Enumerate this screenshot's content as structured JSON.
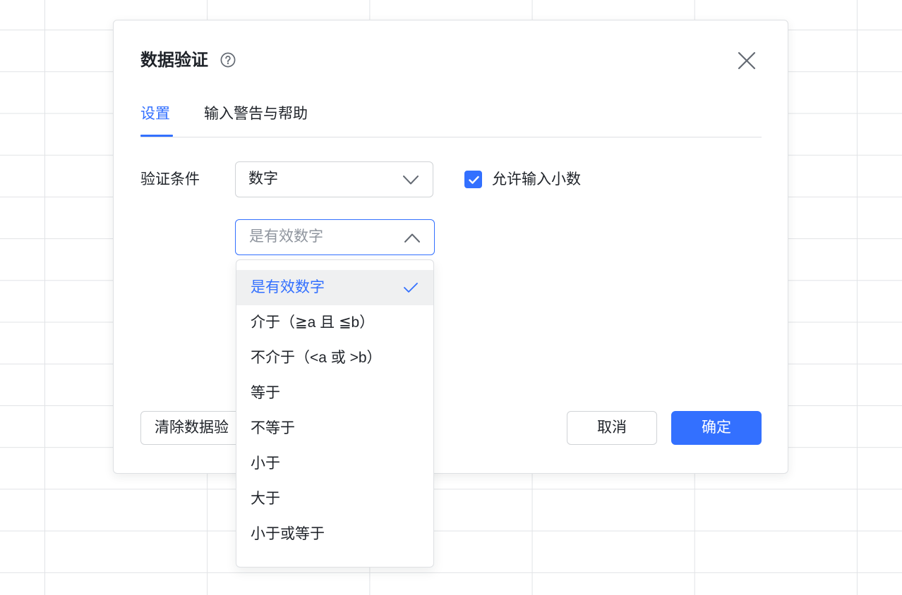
{
  "dialog": {
    "title": "数据验证",
    "help_icon": "help-circle-icon",
    "close_icon": "close-icon",
    "tabs": [
      {
        "label": "设置",
        "active": true
      },
      {
        "label": "输入警告与帮助",
        "active": false
      }
    ],
    "condition_label": "验证条件",
    "type_select": {
      "value": "数字",
      "icon": "chevron-down-icon",
      "expanded": false
    },
    "allow_decimal": {
      "label": "允许输入小数",
      "checked": true,
      "icon": "checkmark-icon"
    },
    "operator_select": {
      "placeholder": "是有效数字",
      "icon": "chevron-up-icon",
      "expanded": true
    },
    "footer": {
      "clear_label": "清除数据验",
      "cancel_label": "取消",
      "confirm_label": "确定"
    }
  },
  "operator_dropdown": {
    "selected_icon": "checkmark-icon",
    "options": [
      {
        "label": "是有效数字",
        "selected": true
      },
      {
        "label": "介于（≧a 且 ≦b）",
        "selected": false
      },
      {
        "label": "不介于（<a 或 >b）",
        "selected": false
      },
      {
        "label": "等于",
        "selected": false
      },
      {
        "label": "不等于",
        "selected": false
      },
      {
        "label": "小于",
        "selected": false
      },
      {
        "label": "大于",
        "selected": false
      },
      {
        "label": "小于或等于",
        "selected": false
      }
    ]
  },
  "colors": {
    "accent": "#3370ff",
    "text": "#1f2329",
    "placeholder": "#8f959e",
    "border": "#d0d3d6",
    "selected_row": "#eff0f1",
    "grid": "#e1e3e6"
  }
}
